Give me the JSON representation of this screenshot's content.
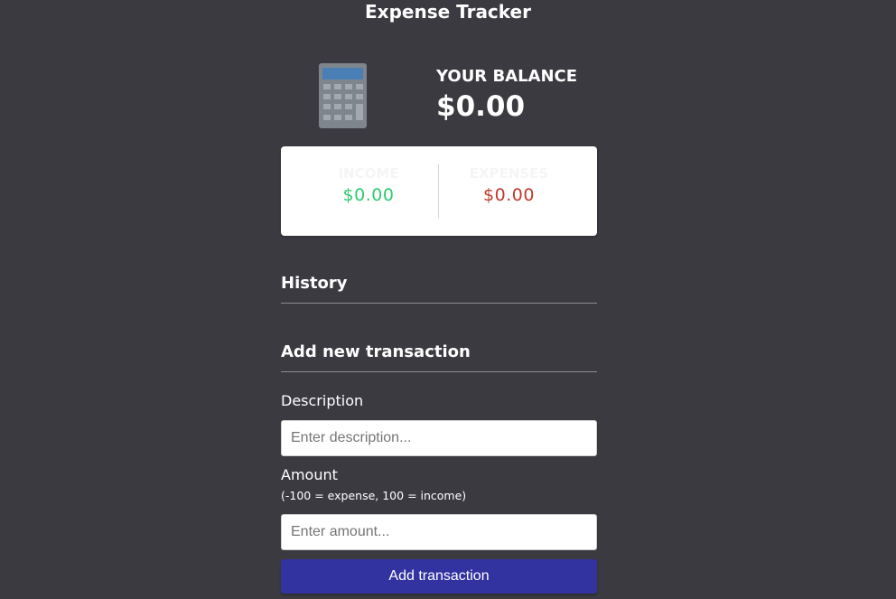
{
  "app": {
    "title": "Expense Tracker"
  },
  "balance": {
    "label": "YOUR BALANCE",
    "value": "$0.00",
    "icon": "calculator-icon"
  },
  "summary": {
    "income_label": "INCOME",
    "income_value": "$0.00",
    "expense_label": "EXPENSES",
    "expense_value": "$0.00",
    "income_color": "#2ecc71",
    "expense_color": "#c0392b"
  },
  "history": {
    "title": "History"
  },
  "form": {
    "title": "Add new transaction",
    "description_label": "Description",
    "description_placeholder": "Enter description...",
    "description_value": "",
    "amount_label": "Amount",
    "amount_hint": "(-100 = expense, 100 = income)",
    "amount_placeholder": "Enter amount...",
    "amount_value": "",
    "submit_label": "Add transaction",
    "submit_color": "#3232a0"
  }
}
